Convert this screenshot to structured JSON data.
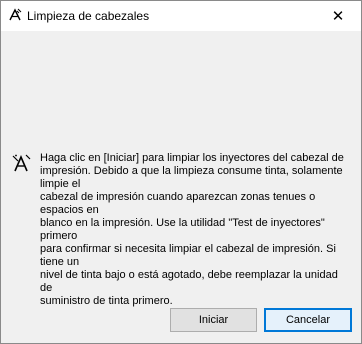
{
  "window": {
    "title": "Limpieza de cabezales",
    "title_icon": "print-head-cleaning-icon",
    "close_glyph": "✕"
  },
  "content": {
    "icon": "print-head-cleaning-icon",
    "message": "Haga clic en [Iniciar] para limpiar los inyectores del cabezal de\nimpresión. Debido a que la limpieza consume tinta, solamente limpie el\ncabezal de impresión cuando aparezcan zonas tenues o espacios en\nblanco en la impresión. Use la utilidad \"Test de inyectores\" primero\npara confirmar si necesita limpiar el cabezal de impresión. Si tiene un\nnivel de tinta bajo o está agotado, debe reemplazar la unidad de\nsuministro de tinta primero."
  },
  "buttons": {
    "start_label": "Iniciar",
    "cancel_label": "Cancelar"
  },
  "colors": {
    "focus_border": "#0078d7",
    "dialog_background": "#f0f0f0"
  }
}
